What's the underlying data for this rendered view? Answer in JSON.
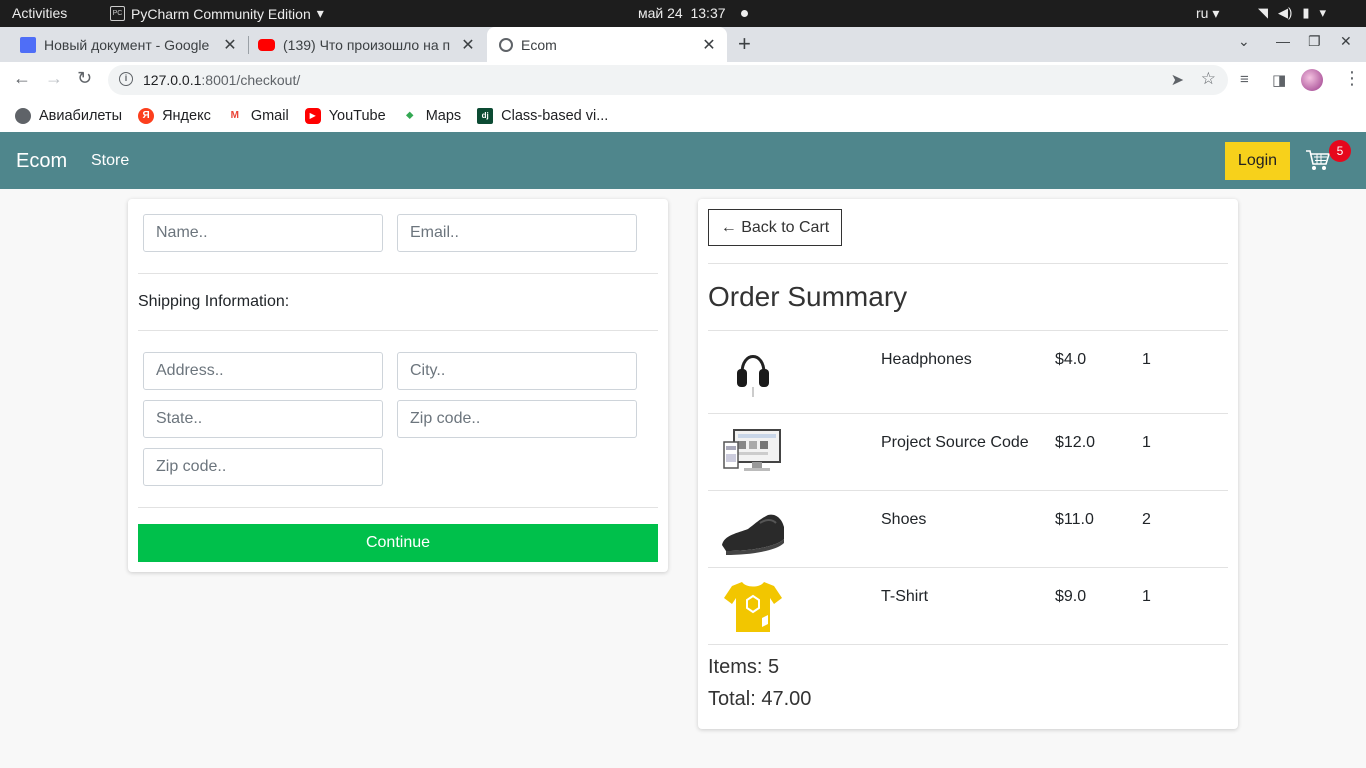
{
  "os_bar": {
    "activities": "Activities",
    "app_name": "PyCharm Community Edition",
    "app_icon_text": "PC",
    "date": "май 24",
    "time": "13:37",
    "language": "ru"
  },
  "browser": {
    "tabs": [
      {
        "title": "Новый документ - Google",
        "favicon": "google-docs-icon",
        "color": "#4f6ef7"
      },
      {
        "title": "(139) Что произошло на п",
        "favicon": "youtube-icon",
        "color": "#ff0000"
      },
      {
        "title": "Ecom",
        "favicon": "globe-icon",
        "color": "#5f6368"
      }
    ],
    "url_host": "127.0.0.1",
    "url_rest": ":8001/checkout/",
    "bookmarks": [
      {
        "label": "Авиабилеты",
        "icon": "globe-icon",
        "color": "#5f6368",
        "glyph": ""
      },
      {
        "label": "Яндекс",
        "icon": "yandex-icon",
        "color": "#fc3f1d",
        "glyph": "Я"
      },
      {
        "label": "Gmail",
        "icon": "gmail-icon",
        "color": "#ea4335",
        "glyph": "M"
      },
      {
        "label": "YouTube",
        "icon": "youtube-icon",
        "color": "#ff0000",
        "glyph": "▶"
      },
      {
        "label": "Maps",
        "icon": "maps-icon",
        "color": "#34a853",
        "glyph": "⬥"
      },
      {
        "label": "Class-based vi...",
        "icon": "django-icon",
        "color": "#0c4b33",
        "glyph": "dj"
      }
    ]
  },
  "site": {
    "brand": "Ecom",
    "nav_store": "Store",
    "login_label": "Login",
    "cart_count": "5",
    "accent": "#4f868c"
  },
  "form": {
    "name_placeholder": "Name..",
    "email_placeholder": "Email..",
    "shipping_label": "Shipping Information:",
    "address_placeholder": "Address..",
    "city_placeholder": "City..",
    "state_placeholder": "State..",
    "zip_placeholder": "Zip code..",
    "zip2_placeholder": "Zip code..",
    "continue_label": "Continue"
  },
  "summary": {
    "back_label": "← Back to Cart",
    "title": "Order Summary",
    "items": [
      {
        "name": "Headphones",
        "price": "$4.0",
        "qty": "1"
      },
      {
        "name": "Project Source Code",
        "price": "$12.0",
        "qty": "1"
      },
      {
        "name": "Shoes",
        "price": "$11.0",
        "qty": "2"
      },
      {
        "name": "T-Shirt",
        "price": "$9.0",
        "qty": "1"
      }
    ],
    "items_line": "Items: 5",
    "total_line": "Total: 47.00"
  }
}
